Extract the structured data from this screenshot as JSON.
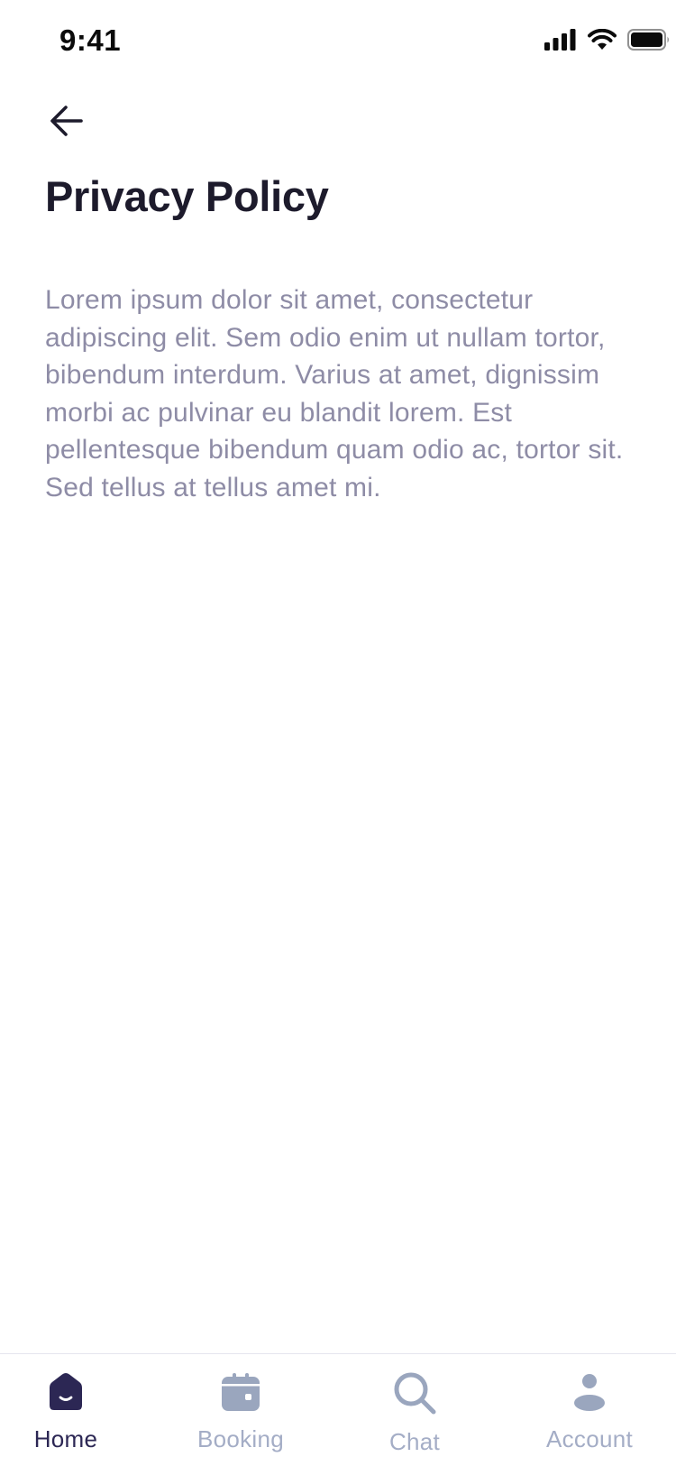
{
  "status_bar": {
    "time": "9:41",
    "icons": [
      "cellular-signal-icon",
      "wifi-icon",
      "battery-icon"
    ]
  },
  "header": {
    "back_icon": "arrow-left-icon",
    "title": "Privacy Policy"
  },
  "content": {
    "body": "Lorem ipsum dolor sit amet, consectetur adipiscing elit. Sem odio enim ut nullam tortor, bibendum interdum. Varius at amet, dignissim morbi ac pulvinar eu blandit lorem. Est pellentesque bibendum quam odio ac, tortor sit. Sed tellus at tellus amet mi."
  },
  "tab_bar": {
    "active_index": 0,
    "items": [
      {
        "label": "Home",
        "icon": "home-icon"
      },
      {
        "label": "Booking",
        "icon": "calendar-icon"
      },
      {
        "label": "Chat",
        "icon": "search-icon"
      },
      {
        "label": "Account",
        "icon": "user-icon"
      }
    ]
  },
  "colors": {
    "title": "#1d1b2c",
    "body_text": "#8e8ca6",
    "tab_active": "#2c2754",
    "tab_inactive": "#a4adc6"
  }
}
